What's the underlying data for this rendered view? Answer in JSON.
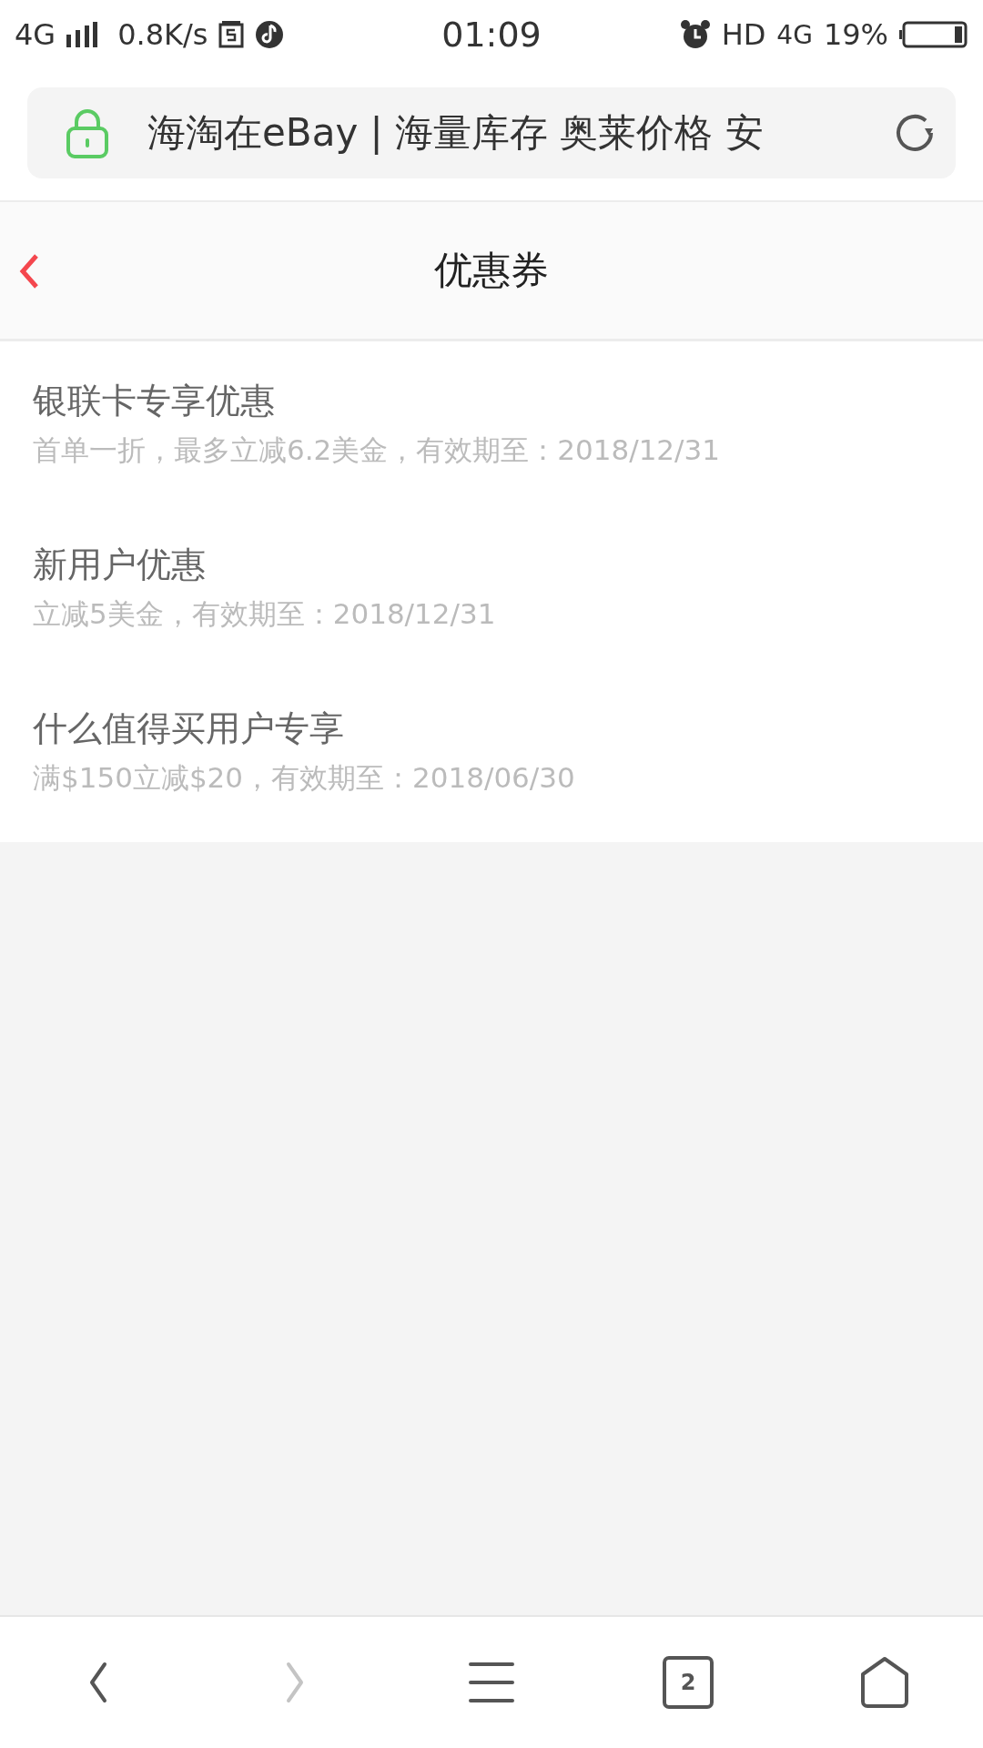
{
  "status_bar": {
    "network": "4G",
    "speed": "0.8K/s",
    "time": "01:09",
    "hd": "HD",
    "network_right": "4G",
    "battery": "19%"
  },
  "address_bar": {
    "title": "海淘在eBay | 海量库存 奥莱价格 安"
  },
  "header": {
    "title": "优惠券"
  },
  "coupons": [
    {
      "title": "银联卡专享优惠",
      "detail": "首单一折，最多立减6.2美金，有效期至：2018/12/31"
    },
    {
      "title": "新用户优惠",
      "detail": "立减5美金，有效期至：2018/12/31"
    },
    {
      "title": "什么值得买用户专享",
      "detail": "满$150立减$20，有效期至：2018/06/30"
    }
  ],
  "bottom_nav": [
    {
      "kind": "back",
      "disabled": false
    },
    {
      "kind": "forward",
      "disabled": true
    },
    {
      "kind": "menu",
      "disabled": false
    },
    {
      "kind": "tabs",
      "disabled": false,
      "count": "2"
    },
    {
      "kind": "home",
      "disabled": false
    }
  ]
}
